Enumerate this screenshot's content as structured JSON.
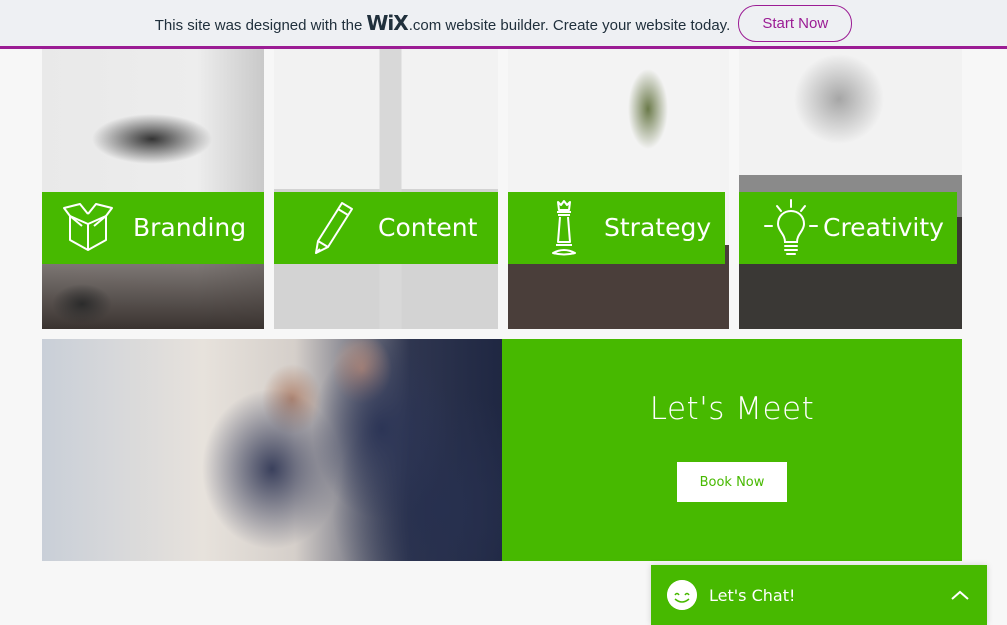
{
  "banner": {
    "text_before": "This site was designed with the",
    "logo_main": "WiX",
    "text_after": ".com website builder. Create your website today.",
    "cta_label": "Start Now",
    "accent_color": "#9b1c94"
  },
  "services": [
    {
      "label": "Branding",
      "icon": "open-box-icon"
    },
    {
      "label": "Content",
      "icon": "pencil-icon"
    },
    {
      "label": "Strategy",
      "icon": "chess-queen-icon"
    },
    {
      "label": "Creativity",
      "icon": "lightbulb-icon"
    }
  ],
  "meet": {
    "title": "Let's Meet",
    "button_label": "Book Now"
  },
  "chat": {
    "label": "Let's Chat!",
    "icon": "smiley-icon",
    "toggle_icon": "chevron-up-icon"
  },
  "colors": {
    "brand_green": "#47b900",
    "banner_bg": "#eef0f3",
    "page_bg": "#f7f7f7"
  }
}
